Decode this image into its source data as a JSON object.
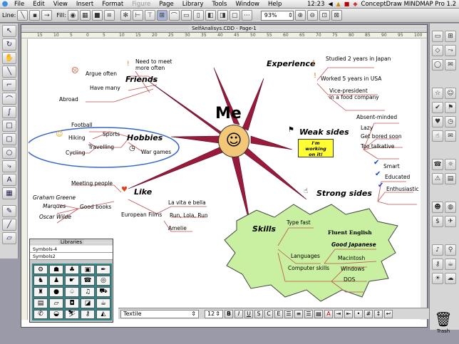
{
  "menubar": {
    "items": [
      "File",
      "Edit",
      "View",
      "Insert",
      "Format",
      "Figure",
      "Page",
      "Library",
      "Tools",
      "Window",
      "Help"
    ],
    "disabled_item": "Figure",
    "time": "12:23",
    "app_name": "ConceptDraw MINDMAP Pro 1.2"
  },
  "toolbar": {
    "line_label": "Line:",
    "fill_label": "Fill:",
    "zoom": "93%"
  },
  "document": {
    "title": "SelfAnalisys.CDD - Page-1",
    "ruler_marks": [
      "15",
      "10",
      "5",
      "0",
      "5",
      "10",
      "15",
      "20",
      "25",
      "30",
      "35",
      "40",
      "45",
      "50",
      "55",
      "60",
      "65",
      "70",
      "75",
      "80",
      "85",
      "90",
      "95",
      "100"
    ]
  },
  "map": {
    "center": "Me",
    "friends": {
      "title": "Friends",
      "items": [
        "Need to meet\nmore often",
        "Argue often",
        "Have many",
        "Abroad"
      ]
    },
    "hobbies": {
      "title": "Hobbies",
      "items": [
        "Football",
        "Sports",
        "Hiking",
        "Travelling",
        "Cycling",
        "War games"
      ]
    },
    "like": {
      "title": "Like",
      "items": [
        "Meeting people",
        "Graham Greene",
        "Marques",
        "Good books",
        "Oscar Wilde",
        "European Films",
        "La vita e bella",
        "Run, Lola, Run",
        "Amelie"
      ]
    },
    "experience": {
      "title": "Experience",
      "items": [
        "Studied 2 years in Japan",
        "Worked 5 years in USA",
        "Vice-president\nin a food company"
      ]
    },
    "weak": {
      "title": "Weak sides",
      "items": [
        "Absent-minded",
        "Lazy",
        "Get bored soon",
        "Too talkative"
      ],
      "callout": "I'm\nworking\non it!"
    },
    "strong": {
      "title": "Strong sides",
      "items": [
        "Smart",
        "Educated",
        "Enthusiastic"
      ]
    },
    "skills": {
      "title": "Skills",
      "items": [
        "Type fast",
        "Fluent English",
        "Good Japanese",
        "Languages",
        "Macintosh",
        "Computer skills",
        "Windows",
        "DOS"
      ]
    }
  },
  "libraries": {
    "title": "Libraries",
    "items": [
      "Symbols-4",
      "Symbols2"
    ]
  },
  "statusbar": {
    "font": "Textile",
    "size": "12",
    "styles": [
      "B",
      "I",
      "U",
      "S",
      "C",
      "E"
    ]
  },
  "trash": {
    "label": "Trash"
  },
  "colors": {
    "spoke": "#9a1a3c",
    "skills_fill": "#c8f0a0",
    "callout_fill": "#ffff33",
    "hobbies_ring": "#3366cc"
  }
}
